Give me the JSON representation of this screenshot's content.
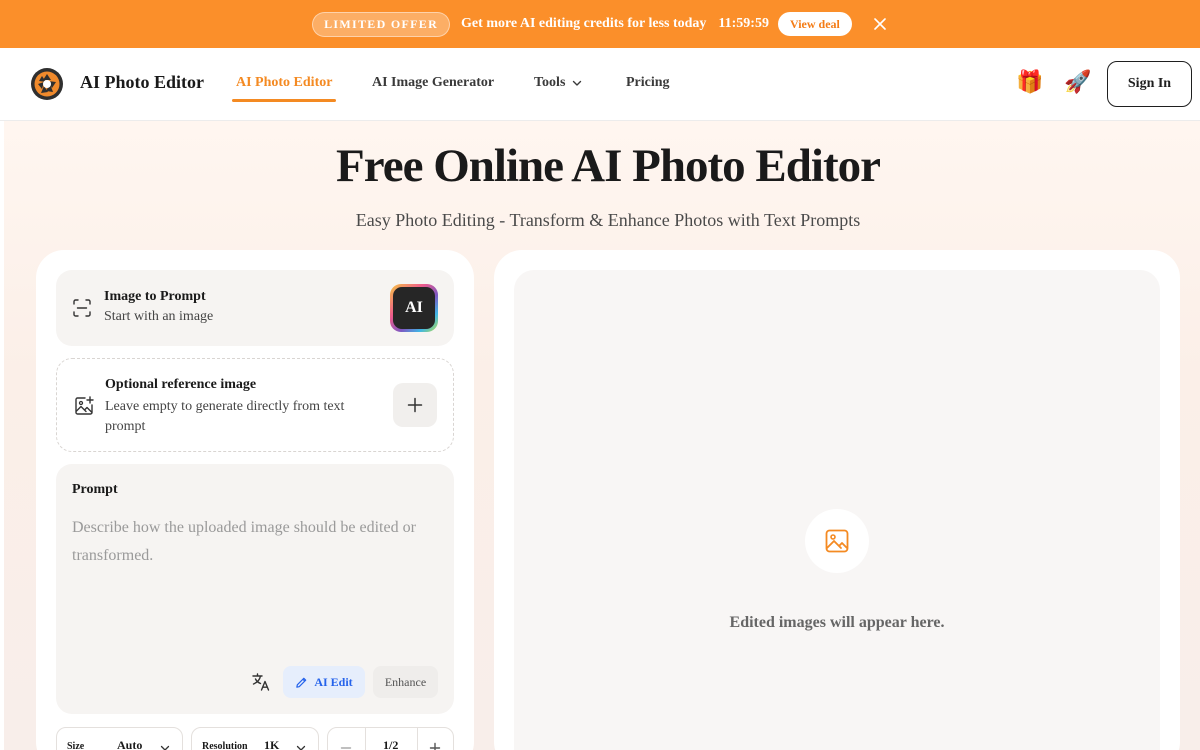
{
  "banner": {
    "offer_label": "LIMITED OFFER",
    "message": "Get more AI editing credits for less today",
    "countdown": "11:59:59",
    "cta": "View deal"
  },
  "header": {
    "brand": "AI Photo Editor",
    "nav": [
      {
        "label": "AI Photo Editor",
        "active": true
      },
      {
        "label": "AI Image Generator",
        "active": false
      },
      {
        "label": "Tools",
        "active": false
      },
      {
        "label": "Pricing",
        "active": false
      }
    ],
    "gift_emoji": "🎁",
    "rocket_emoji": "🚀",
    "signin": "Sign In"
  },
  "hero": {
    "title": "Free Online AI Photo Editor",
    "subtitle": "Easy Photo Editing - Transform & Enhance Photos with Text Prompts"
  },
  "image_to_prompt": {
    "title": "Image to Prompt",
    "subtitle": "Start with an image",
    "badge": "AI"
  },
  "reference": {
    "title": "Optional reference image",
    "subtitle": "Leave empty to generate directly from text prompt"
  },
  "prompt": {
    "label": "Prompt",
    "value": "",
    "placeholder": "Describe how the uploaded image should be edited or transformed.",
    "ai_edit": "AI Edit",
    "enhance": "Enhance"
  },
  "options": {
    "size_label": "Size",
    "size_value": "Auto",
    "resolution_label": "Resolution",
    "resolution_value": "1K",
    "count": "1/2"
  },
  "output": {
    "empty_text": "Edited images will appear here."
  },
  "colors": {
    "accent": "#f48a22",
    "banner": "#fb8f2a",
    "ai_edit": "#2563eb"
  }
}
